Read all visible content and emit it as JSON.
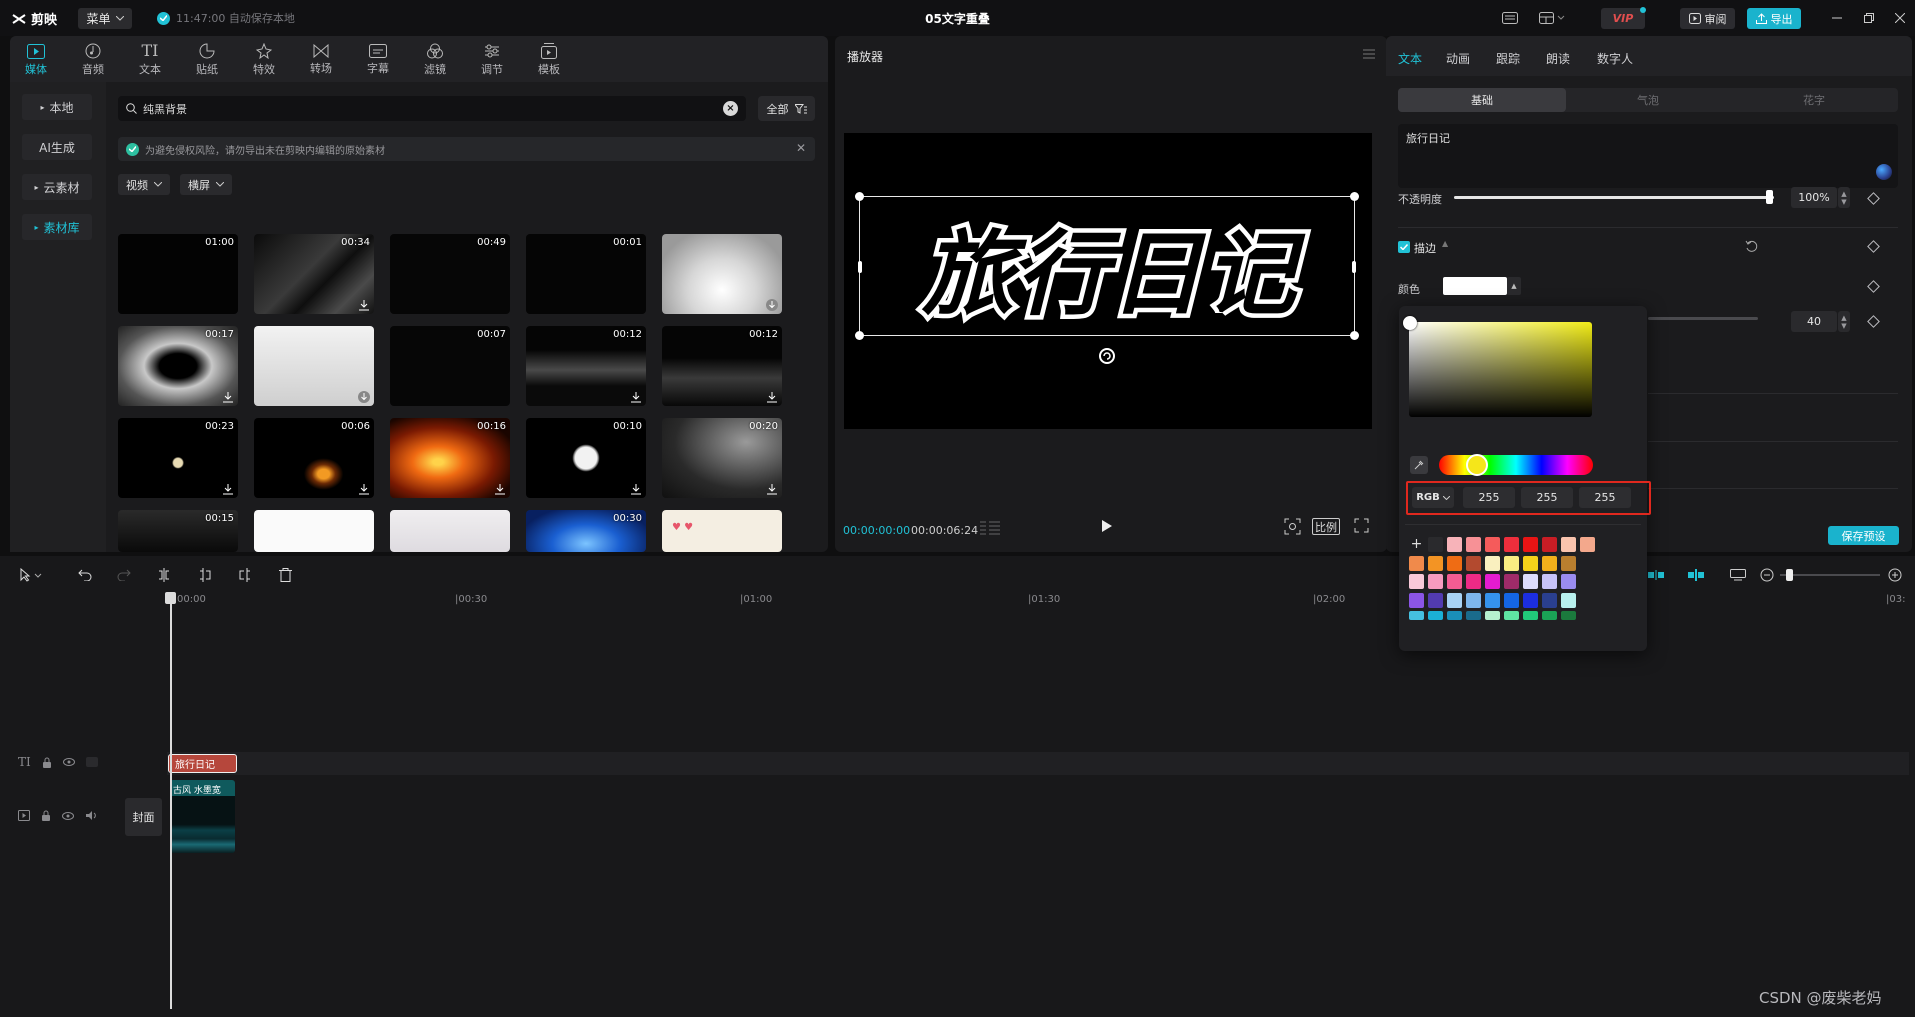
{
  "app": {
    "name": "剪映",
    "menu_label": "菜单",
    "autosave_text": "11:47:00 自动保存本地",
    "project_title": "05文字重叠",
    "vip_label": "VIP",
    "review_label": "审阅",
    "export_label": "导出"
  },
  "media": {
    "tabs": [
      {
        "label": "媒体",
        "icon": "media-icon"
      },
      {
        "label": "音频",
        "icon": "audio-icon"
      },
      {
        "label": "文本",
        "icon": "text-icon"
      },
      {
        "label": "贴纸",
        "icon": "sticker-icon"
      },
      {
        "label": "特效",
        "icon": "effects-icon"
      },
      {
        "label": "转场",
        "icon": "transition-icon"
      },
      {
        "label": "字幕",
        "icon": "subtitle-icon"
      },
      {
        "label": "滤镜",
        "icon": "filter-icon"
      },
      {
        "label": "调节",
        "icon": "adjust-icon"
      },
      {
        "label": "模板",
        "icon": "template-icon"
      }
    ],
    "sidebar": [
      "本地",
      "AI生成",
      "云素材",
      "素材库"
    ],
    "search_value": "纯黑背景",
    "filter_all_label": "全部",
    "notice": "为避免侵权风险，请勿导出未在剪映内编辑的原始素材",
    "dropdown_type": "视频",
    "dropdown_orientation": "横屏",
    "durations": [
      "01:00",
      "00:34",
      "00:49",
      "00:01",
      "",
      "00:17",
      "",
      "00:07",
      "00:12",
      "00:12",
      "00:23",
      "00:06",
      "00:16",
      "00:10",
      "00:20",
      "00:15",
      "",
      "",
      "00:30",
      ""
    ]
  },
  "player": {
    "title": "播放器",
    "caption_text": "旅行日记",
    "time_current": "00:00:00:00",
    "time_total": "00:00:06:24",
    "ratio_label": "比例"
  },
  "props": {
    "tabs": [
      "文本",
      "动画",
      "跟踪",
      "朗读",
      "数字人"
    ],
    "segments": [
      "基础",
      "气泡",
      "花字"
    ],
    "text_value": "旅行日记",
    "opacity_label": "不透明度",
    "opacity_value": "100%",
    "opacity_level": 1.0,
    "stroke_label": "描边",
    "color_label": "颜色",
    "thickness_value": "40",
    "save_preset_label": "保存预设"
  },
  "color_picker": {
    "mode": "RGB",
    "r": "255",
    "g": "255",
    "b": "255",
    "hue_color": "#f1ec17",
    "swatch_rows": [
      [
        "#2a2a2d",
        "#f7b3b9",
        "#f79196",
        "#f55b5b",
        "#ee2e3c",
        "#e81414",
        "#c81d25",
        "#f9c4ae",
        "#f3a88c"
      ],
      [
        "#f08a4b",
        "#f39424",
        "#ef6c14",
        "#b34a2f",
        "#f9f0bf",
        "#f9ed82",
        "#f4d21a",
        "#f2b01b",
        "#b97f2f"
      ],
      [
        "#f9c9d9",
        "#f79bbf",
        "#f45c93",
        "#ee2a86",
        "#e51bd0",
        "#9f2b69",
        "#ddddfc",
        "#c7c3f8",
        "#9a8cf0"
      ],
      [
        "#8b55e6",
        "#523bb0",
        "#a8d3f5",
        "#7db6ec",
        "#3593ec",
        "#1466e4",
        "#1c2ee0",
        "#2a3f8f",
        "#b8f1ee"
      ],
      [
        "#45c0e0",
        "#1bb0d6",
        "#1a8fb8",
        "#1a6b8c",
        "#b6f0cf",
        "#5fe3a3",
        "#21c97a",
        "#1aa356",
        "#1b7a3d"
      ]
    ]
  },
  "timeline": {
    "ruler": [
      "00:00",
      "|00:30",
      "|01:00",
      "|01:30",
      "|02:00",
      "|03:"
    ],
    "text_clip_label": "旅行日记",
    "video_clip_label": "古风 水墨宽",
    "cover_label": "封面"
  },
  "watermark": "CSDN @废柴老妈"
}
